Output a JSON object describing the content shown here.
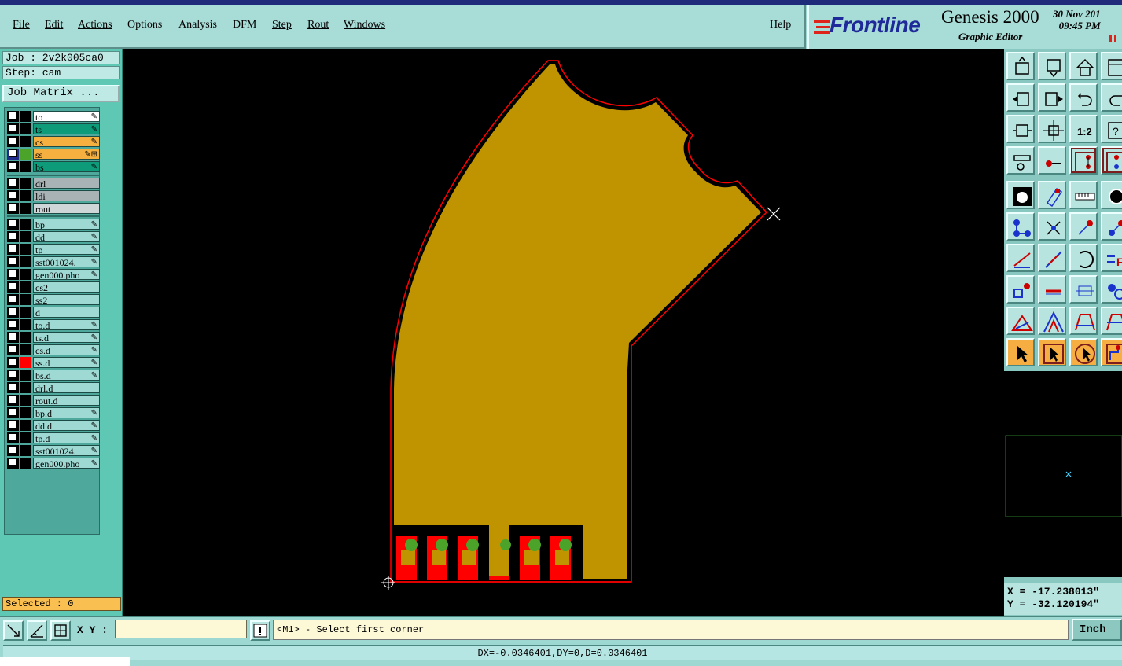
{
  "menubar": {
    "items": [
      "File",
      "Edit",
      "Actions",
      "Options",
      "Analysis",
      "DFM",
      "Step",
      "Rout",
      "Windows"
    ],
    "help": "Help"
  },
  "brand": {
    "logo": "Frontline",
    "title": "Genesis 2000",
    "subtitle": "Graphic Editor",
    "date": "30 Nov 201",
    "time": "09:45 PM"
  },
  "job": {
    "job_line": "Job : 2v2k005ca0",
    "step_line": "Step: cam",
    "matrix_button": "Job Matrix ..."
  },
  "layers": {
    "group1": [
      {
        "name": "to",
        "color": "#ffffff",
        "mark": "✎"
      },
      {
        "name": "ts",
        "color": "#0d9b7a",
        "mark": "✎"
      },
      {
        "name": "cs",
        "color": "#f5b040",
        "mark": "✎"
      },
      {
        "name": "ss",
        "color": "#f5b040",
        "mark": "✎⊞",
        "selected": true
      },
      {
        "name": "bs",
        "color": "#0d9b7a",
        "mark": "✎"
      }
    ],
    "group2": [
      {
        "name": "drl",
        "color": "#a9b3b5",
        "mark": ""
      },
      {
        "name": "ldi",
        "color": "#a9b3b5",
        "mark": ""
      },
      {
        "name": "rout",
        "color": "#cfd6d8",
        "mark": ""
      }
    ],
    "group3": [
      {
        "name": "bp",
        "color": "#9fd9d3",
        "mark": "✎"
      },
      {
        "name": "dd",
        "color": "#9fd9d3",
        "mark": "✎"
      },
      {
        "name": "tp",
        "color": "#9fd9d3",
        "mark": "✎"
      },
      {
        "name": "sst001024.",
        "color": "#9fd9d3",
        "mark": "✎"
      },
      {
        "name": "gen000.pho",
        "color": "#9fd9d3",
        "mark": "✎"
      },
      {
        "name": "cs2",
        "color": "#9fd9d3",
        "mark": ""
      },
      {
        "name": "ss2",
        "color": "#9fd9d3",
        "mark": ""
      },
      {
        "name": "d",
        "color": "#9fd9d3",
        "mark": ""
      },
      {
        "name": "to.d",
        "color": "#9fd9d3",
        "mark": "✎"
      },
      {
        "name": "ts.d",
        "color": "#9fd9d3",
        "mark": "✎"
      },
      {
        "name": "cs.d",
        "color": "#9fd9d3",
        "mark": "✎"
      },
      {
        "name": "ss.d",
        "color": "#9fd9d3",
        "mark": "✎",
        "work": true
      },
      {
        "name": "bs.d",
        "color": "#9fd9d3",
        "mark": "✎"
      },
      {
        "name": "drl.d",
        "color": "#9fd9d3",
        "mark": ""
      },
      {
        "name": "rout.d",
        "color": "#9fd9d3",
        "mark": ""
      },
      {
        "name": "bp.d",
        "color": "#9fd9d3",
        "mark": "✎"
      },
      {
        "name": "dd.d",
        "color": "#9fd9d3",
        "mark": "✎"
      },
      {
        "name": "tp.d",
        "color": "#9fd9d3",
        "mark": "✎"
      },
      {
        "name": "sst001024.",
        "color": "#9fd9d3",
        "mark": "✎"
      },
      {
        "name": "gen000.pho",
        "color": "#9fd9d3",
        "mark": "✎"
      }
    ]
  },
  "selected": "Selected : 0",
  "coords": {
    "x": "X = -17.238013\"",
    "y": "Y = -32.120194\""
  },
  "bottom": {
    "xy_label": "X Y :",
    "xy_value": "",
    "prompt": "<M1> - Select first corner",
    "unit": "Inch",
    "status": "DX=-0.0346401,DY=0,D=0.0346401"
  },
  "colors": {
    "board_fill": "#bf9400",
    "outline": "#ff0000",
    "pad_red": "#ff0000",
    "pad_green": "#4ca32a",
    "canvas_bg": "#000000"
  }
}
